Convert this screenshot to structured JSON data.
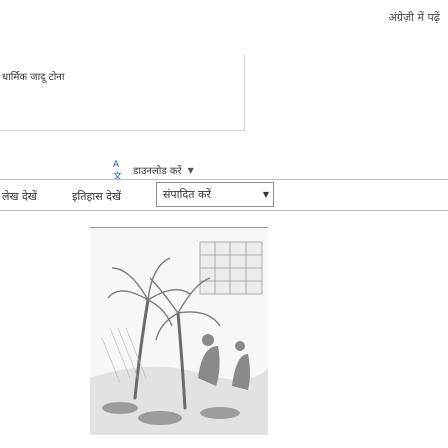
{
  "header": {
    "top_right_link": "अंग्रेज़ी में पढ़ें"
  },
  "article": {
    "title": "धार्मिक जादू टोना"
  },
  "language_selector": {
    "label": "डाउनलोड करें"
  },
  "tabs": {
    "items": [
      "लेख देखें",
      "इतिहास देखें"
    ],
    "select_value": "संपादित करें"
  },
  "illustration": {
    "description_icon": "palm-tree-landscape-illustration"
  },
  "colors": {
    "translate_icon": "#1a4fd1",
    "divider": "#bdbdbd"
  }
}
